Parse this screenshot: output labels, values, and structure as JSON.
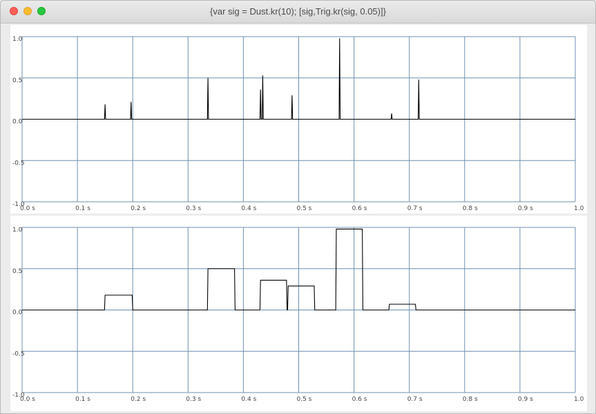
{
  "window": {
    "title": "{var sig = Dust.kr(10); [sig,Trig.kr(sig, 0.05)]}"
  },
  "colors": {
    "grid": "#6d8fb0",
    "trace": "#000000",
    "plot_bg": "#ffffff",
    "panel_bg": "#ececec"
  },
  "chart_data": [
    {
      "type": "line",
      "title": "",
      "xlabel": "",
      "ylabel": "",
      "xlim": [
        0.0,
        1.0
      ],
      "ylim": [
        -1.0,
        1.0
      ],
      "grid": true,
      "xticks": [
        "0.0 s",
        "0.1 s",
        "0.2 s",
        "0.3 s",
        "0.4 s",
        "0.5 s",
        "0.6 s",
        "0.7 s",
        "0.8 s",
        "0.9 s",
        "1.0"
      ],
      "yticks": [
        "1.0",
        "0.5",
        "0.0",
        "-0.5",
        "-1.0"
      ],
      "series": [
        {
          "x": [
            0.0,
            0.149,
            0.15,
            0.151,
            0.196,
            0.197,
            0.198,
            0.335,
            0.336,
            0.337,
            0.43,
            0.431,
            0.432,
            0.434,
            0.435,
            0.436,
            0.487,
            0.488,
            0.489,
            0.573,
            0.574,
            0.575,
            0.667,
            0.668,
            0.669,
            0.716,
            0.717,
            0.718,
            1.0
          ],
          "y": [
            0.0,
            0.0,
            0.18,
            0.0,
            0.0,
            0.21,
            0.0,
            0.0,
            0.5,
            0.0,
            0.0,
            0.36,
            0.0,
            0.0,
            0.53,
            0.0,
            0.0,
            0.29,
            0.0,
            0.0,
            0.98,
            0.0,
            0.0,
            0.07,
            0.0,
            0.0,
            0.48,
            0.0,
            0.0
          ]
        }
      ]
    },
    {
      "type": "line",
      "title": "",
      "xlabel": "",
      "ylabel": "",
      "xlim": [
        0.0,
        1.0
      ],
      "ylim": [
        -1.0,
        1.0
      ],
      "grid": true,
      "xticks": [
        "0.0 s",
        "0.1 s",
        "0.2 s",
        "0.3 s",
        "0.4 s",
        "0.5 s",
        "0.6 s",
        "0.7 s",
        "0.8 s",
        "0.9 s",
        "1.0"
      ],
      "yticks": [
        "1.0",
        "0.5",
        "0.0",
        "-0.5",
        "-1.0"
      ],
      "series": [
        {
          "x": [
            0.0,
            0.149,
            0.15,
            0.199,
            0.2,
            0.335,
            0.336,
            0.384,
            0.385,
            0.43,
            0.431,
            0.478,
            0.479,
            0.48,
            0.481,
            0.528,
            0.529,
            0.567,
            0.568,
            0.615,
            0.616,
            0.663,
            0.664,
            0.711,
            0.712,
            1.0
          ],
          "y": [
            0.0,
            0.0,
            0.18,
            0.18,
            0.0,
            0.0,
            0.5,
            0.5,
            0.0,
            0.0,
            0.36,
            0.36,
            0.0,
            0.0,
            0.29,
            0.29,
            0.0,
            0.0,
            0.98,
            0.98,
            0.0,
            0.0,
            0.07,
            0.07,
            0.0,
            0.0
          ]
        }
      ]
    }
  ]
}
